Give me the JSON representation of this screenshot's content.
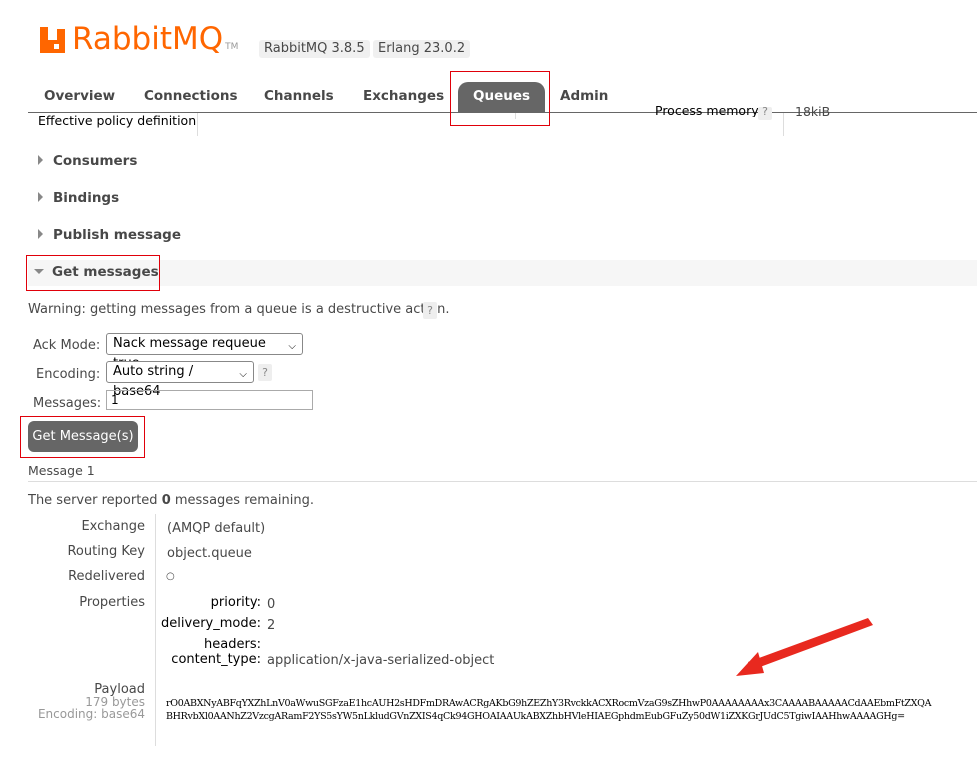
{
  "header": {
    "logo_text": "RabbitMQ",
    "logo_tm": "TM",
    "version_badge": "RabbitMQ 3.8.5",
    "erlang_badge": "Erlang 23.0.2"
  },
  "tabs": [
    {
      "label": "Overview"
    },
    {
      "label": "Connections"
    },
    {
      "label": "Channels"
    },
    {
      "label": "Exchanges"
    },
    {
      "label": "Queues",
      "active": true
    },
    {
      "label": "Admin"
    }
  ],
  "top_row": {
    "policy_label": "Effective policy definition",
    "process_memory_label": "Process memory",
    "process_memory_help": "?",
    "process_memory_value": "18kiB"
  },
  "sections": {
    "consumers": "Consumers",
    "bindings": "Bindings",
    "publish_message": "Publish message",
    "get_messages": "Get messages"
  },
  "get_messages": {
    "warning": "Warning: getting messages from a queue is a destructive action.",
    "warning_help": "?",
    "ack_mode_label": "Ack Mode:",
    "ack_mode_value": "Nack message requeue true",
    "encoding_label": "Encoding:",
    "encoding_value": "Auto string / base64",
    "encoding_help": "?",
    "messages_label": "Messages:",
    "messages_value": "1",
    "button_label": "Get Message(s)"
  },
  "message": {
    "title": "Message 1",
    "remaining_prefix": "The server reported ",
    "remaining_count": "0",
    "remaining_suffix": " messages remaining.",
    "exchange_label": "Exchange",
    "exchange_value": "(AMQP default)",
    "routing_key_label": "Routing Key",
    "routing_key_value": "object.queue",
    "redelivered_label": "Redelivered",
    "redelivered_value": "○",
    "properties_label": "Properties",
    "properties": [
      {
        "key": "priority:",
        "value": "0"
      },
      {
        "key": "delivery_mode:",
        "value": "2"
      },
      {
        "key": "headers:",
        "value": ""
      },
      {
        "key": "content_type:",
        "value": "application/x-java-serialized-object"
      }
    ],
    "payload_label": "Payload",
    "payload_size": "179 bytes",
    "payload_encoding": "Encoding: base64",
    "payload_line1": "rO0ABXNyABFqYXZhLnV0aWwuSGFzaE1hcAUH2sHDFmDRAwACRgAKbG9hZEZhY3RvckkACXRocmVzaG9sZHhwP0AAAAAAAAx3CAAAABAAAAACdAAEbmFtZXQA",
    "payload_line2": "BHRvbXl0AANhZ2VzcgARamF2YS5sYW5nLkludGVnZXIS4qCk94GHOAIAAUkABXZhbHVleHIAEGphdmEubGFuZy50dW1iZXKGrJUdC5TgiwIAAHhwAAAAGHg="
  },
  "colors": {
    "accent": "#ff6600",
    "tab_active_bg": "#666666",
    "highlight_border": "#e0000a",
    "arrow": "#e8291f"
  }
}
